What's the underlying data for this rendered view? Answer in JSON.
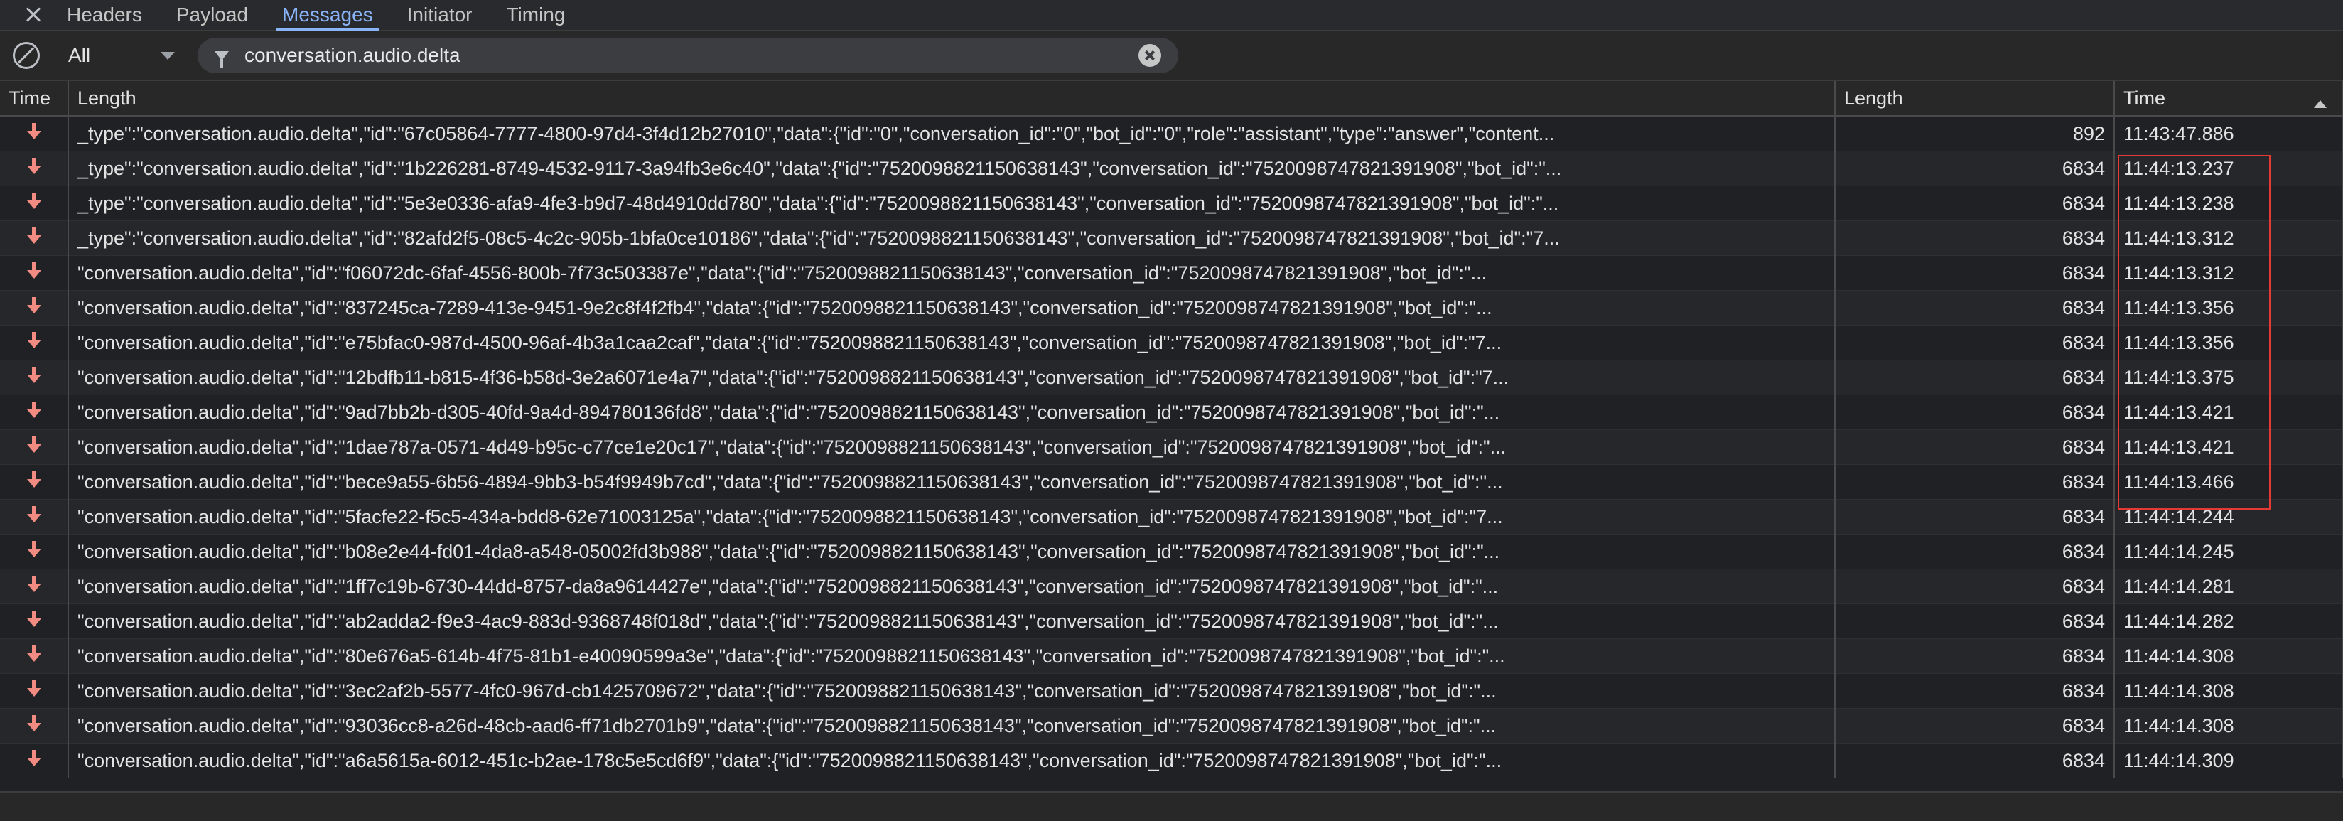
{
  "tabs": [
    {
      "label": "Headers"
    },
    {
      "label": "Payload"
    },
    {
      "label": "Messages"
    },
    {
      "label": "Initiator"
    },
    {
      "label": "Timing"
    }
  ],
  "active_tab": "Messages",
  "filter": {
    "type_select": "All",
    "search_value": "conversation.audio.delta"
  },
  "columns": {
    "time_icon": "Time",
    "data": "Length",
    "length": "Length",
    "time": "Time"
  },
  "rows": [
    {
      "data": "_type\":\"conversation.audio.delta\",\"id\":\"67c05864-7777-4800-97d4-3f4d12b27010\",\"data\":{\"id\":\"0\",\"conversation_id\":\"0\",\"bot_id\":\"0\",\"role\":\"assistant\",\"type\":\"answer\",\"content...",
      "length": "892",
      "time": "11:43:47.886"
    },
    {
      "data": "_type\":\"conversation.audio.delta\",\"id\":\"1b226281-8749-4532-9117-3a94fb3e6c40\",\"data\":{\"id\":\"7520098821150638143\",\"conversation_id\":\"7520098747821391908\",\"bot_id\":\"...",
      "length": "6834",
      "time": "11:44:13.237"
    },
    {
      "data": "_type\":\"conversation.audio.delta\",\"id\":\"5e3e0336-afa9-4fe3-b9d7-48d4910dd780\",\"data\":{\"id\":\"7520098821150638143\",\"conversation_id\":\"7520098747821391908\",\"bot_id\":\"...",
      "length": "6834",
      "time": "11:44:13.238"
    },
    {
      "data": "_type\":\"conversation.audio.delta\",\"id\":\"82afd2f5-08c5-4c2c-905b-1bfa0ce10186\",\"data\":{\"id\":\"7520098821150638143\",\"conversation_id\":\"7520098747821391908\",\"bot_id\":\"7...",
      "length": "6834",
      "time": "11:44:13.312"
    },
    {
      "data": "\"conversation.audio.delta\",\"id\":\"f06072dc-6faf-4556-800b-7f73c503387e\",\"data\":{\"id\":\"7520098821150638143\",\"conversation_id\":\"7520098747821391908\",\"bot_id\":\"...",
      "length": "6834",
      "time": "11:44:13.312"
    },
    {
      "data": "\"conversation.audio.delta\",\"id\":\"837245ca-7289-413e-9451-9e2c8f4f2fb4\",\"data\":{\"id\":\"7520098821150638143\",\"conversation_id\":\"7520098747821391908\",\"bot_id\":\"...",
      "length": "6834",
      "time": "11:44:13.356"
    },
    {
      "data": "\"conversation.audio.delta\",\"id\":\"e75bfac0-987d-4500-96af-4b3a1caa2caf\",\"data\":{\"id\":\"7520098821150638143\",\"conversation_id\":\"7520098747821391908\",\"bot_id\":\"7...",
      "length": "6834",
      "time": "11:44:13.356"
    },
    {
      "data": "\"conversation.audio.delta\",\"id\":\"12bdfb11-b815-4f36-b58d-3e2a6071e4a7\",\"data\":{\"id\":\"7520098821150638143\",\"conversation_id\":\"7520098747821391908\",\"bot_id\":\"7...",
      "length": "6834",
      "time": "11:44:13.375"
    },
    {
      "data": "\"conversation.audio.delta\",\"id\":\"9ad7bb2b-d305-40fd-9a4d-894780136fd8\",\"data\":{\"id\":\"7520098821150638143\",\"conversation_id\":\"7520098747821391908\",\"bot_id\":\"...",
      "length": "6834",
      "time": "11:44:13.421"
    },
    {
      "data": "\"conversation.audio.delta\",\"id\":\"1dae787a-0571-4d49-b95c-c77ce1e20c17\",\"data\":{\"id\":\"7520098821150638143\",\"conversation_id\":\"7520098747821391908\",\"bot_id\":\"...",
      "length": "6834",
      "time": "11:44:13.421"
    },
    {
      "data": "\"conversation.audio.delta\",\"id\":\"bece9a55-6b56-4894-9bb3-b54f9949b7cd\",\"data\":{\"id\":\"7520098821150638143\",\"conversation_id\":\"7520098747821391908\",\"bot_id\":\"...",
      "length": "6834",
      "time": "11:44:13.466"
    },
    {
      "data": "\"conversation.audio.delta\",\"id\":\"5facfe22-f5c5-434a-bdd8-62e71003125a\",\"data\":{\"id\":\"7520098821150638143\",\"conversation_id\":\"7520098747821391908\",\"bot_id\":\"7...",
      "length": "6834",
      "time": "11:44:14.244"
    },
    {
      "data": "\"conversation.audio.delta\",\"id\":\"b08e2e44-fd01-4da8-a548-05002fd3b988\",\"data\":{\"id\":\"7520098821150638143\",\"conversation_id\":\"7520098747821391908\",\"bot_id\":\"...",
      "length": "6834",
      "time": "11:44:14.245"
    },
    {
      "data": "\"conversation.audio.delta\",\"id\":\"1ff7c19b-6730-44dd-8757-da8a9614427e\",\"data\":{\"id\":\"7520098821150638143\",\"conversation_id\":\"7520098747821391908\",\"bot_id\":\"...",
      "length": "6834",
      "time": "11:44:14.281"
    },
    {
      "data": "\"conversation.audio.delta\",\"id\":\"ab2adda2-f9e3-4ac9-883d-9368748f018d\",\"data\":{\"id\":\"7520098821150638143\",\"conversation_id\":\"7520098747821391908\",\"bot_id\":\"...",
      "length": "6834",
      "time": "11:44:14.282"
    },
    {
      "data": "\"conversation.audio.delta\",\"id\":\"80e676a5-614b-4f75-81b1-e40090599a3e\",\"data\":{\"id\":\"7520098821150638143\",\"conversation_id\":\"7520098747821391908\",\"bot_id\":\"...",
      "length": "6834",
      "time": "11:44:14.308"
    },
    {
      "data": "\"conversation.audio.delta\",\"id\":\"3ec2af2b-5577-4fc0-967d-cb1425709672\",\"data\":{\"id\":\"7520098821150638143\",\"conversation_id\":\"7520098747821391908\",\"bot_id\":\"...",
      "length": "6834",
      "time": "11:44:14.308"
    },
    {
      "data": "\"conversation.audio.delta\",\"id\":\"93036cc8-a26d-48cb-aad6-ff71db2701b9\",\"data\":{\"id\":\"7520098821150638143\",\"conversation_id\":\"7520098747821391908\",\"bot_id\":\"...",
      "length": "6834",
      "time": "11:44:14.308"
    },
    {
      "data": "\"conversation.audio.delta\",\"id\":\"a6a5615a-6012-451c-b2ae-178c5e5cd6f9\",\"data\":{\"id\":\"7520098821150638143\",\"conversation_id\":\"7520098747821391908\",\"bot_id\":\"...",
      "length": "6834",
      "time": "11:44:14.309"
    }
  ],
  "colors": {
    "active_tab": "#8ab4f8",
    "received_arrow": "#f28b82",
    "highlight_box": "#e53935",
    "background": "#202124"
  },
  "icons": {
    "close": "close-icon",
    "clear_messages": "block-icon",
    "filter": "filter-icon",
    "clear_search": "clear-search-icon",
    "received": "arrow-down-icon",
    "sort": "sort-ascending-icon"
  }
}
